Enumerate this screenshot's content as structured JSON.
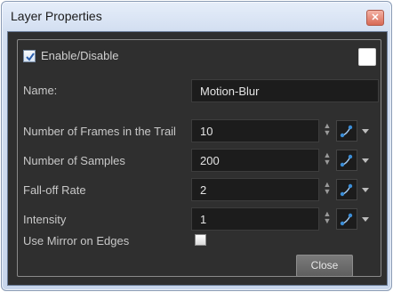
{
  "window": {
    "title": "Layer Properties"
  },
  "enable": {
    "label": "Enable/Disable",
    "checked": true,
    "color_swatch": "#ffffff"
  },
  "fields": {
    "name": {
      "label": "Name:",
      "value": "Motion-Blur"
    },
    "frames_in_trail": {
      "label": "Number of Frames in the Trail",
      "value": "10"
    },
    "samples": {
      "label": "Number of Samples",
      "value": "200"
    },
    "falloff_rate": {
      "label": "Fall-off Rate",
      "value": "2"
    },
    "intensity": {
      "label": "Intensity",
      "value": "1"
    }
  },
  "mirror_edges": {
    "label": "Use Mirror on Edges",
    "checked": false
  },
  "buttons": {
    "close": "Close"
  },
  "icons": {
    "close": "close-icon",
    "spin": "spinner-icon",
    "function": "function-curve-icon",
    "dropdown": "chevron-down-icon"
  },
  "colors": {
    "background": "#2f2f2f",
    "field": "#1c1c1c",
    "accent": "#3b8ed8"
  }
}
